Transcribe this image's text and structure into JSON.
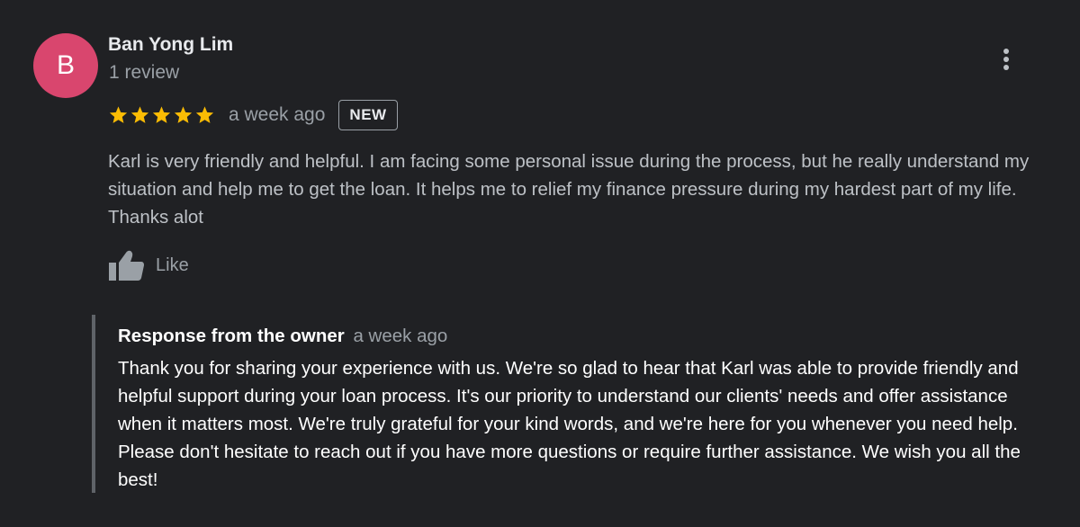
{
  "reviewer": {
    "avatar_letter": "B",
    "avatar_color": "#d9466e",
    "name": "Ban Yong Lim",
    "review_count": "1 review"
  },
  "review": {
    "rating": 5,
    "max_rating": 5,
    "star_color": "#fbbc04",
    "time_ago": "a week ago",
    "badge": "NEW",
    "text": "Karl is very friendly and helpful. I am facing some personal issue during the process, but he really understand my situation and help me to get the loan. It helps me to relief my finance pressure during my hardest part of my life. Thanks alot",
    "like_label": "Like",
    "like_icon": "thumbs-up-icon",
    "more_icon": "more-vert-icon"
  },
  "owner_response": {
    "title": "Response from the owner",
    "time_ago": "a week ago",
    "text": "Thank you for sharing your experience with us. We're so glad to hear that Karl was able to provide friendly and helpful support during your loan process. It's our priority to understand our clients' needs and offer assistance when it matters most. We're truly grateful for your kind words, and we're here for you whenever you need help. Please don't hesitate to reach out if you have more questions or require further assistance. We wish you all the best!"
  }
}
